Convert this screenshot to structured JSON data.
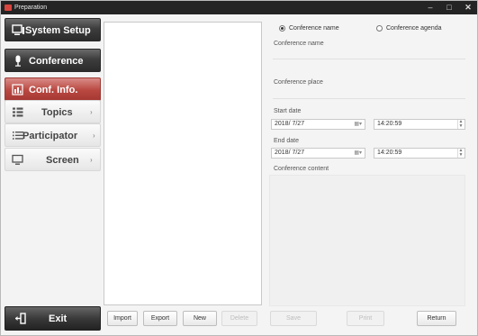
{
  "window": {
    "title": "Preparation",
    "min": "–",
    "max": "□",
    "close": "✕"
  },
  "sidebar": {
    "items": [
      {
        "label": "System Setup",
        "icon": "monitor-icon",
        "style": "dark"
      },
      {
        "label": "Conference",
        "icon": "microphone-icon",
        "style": "dark"
      },
      {
        "label": "Conf. Info.",
        "icon": "info-chart-icon",
        "style": "active"
      },
      {
        "label": "Topics",
        "icon": "list-icon",
        "style": "light",
        "chevron": "›"
      },
      {
        "label": "Participator",
        "icon": "list-lines-icon",
        "style": "light",
        "chevron": "›"
      },
      {
        "label": "Screen",
        "icon": "screen-icon",
        "style": "light",
        "chevron": "›"
      }
    ],
    "exit_label": "Exit"
  },
  "form": {
    "radio_name": "Conference name",
    "radio_agenda": "Conference agenda",
    "selected": "Conference name",
    "conference_name_label": "Conference name",
    "conference_place_label": "Conference place",
    "start_date_label": "Start date",
    "start_date": "2018/ 7/27",
    "start_time": "14:20:59",
    "end_date_label": "End date",
    "end_date": "2018/ 7/27",
    "end_time": "14:20:59",
    "content_label": "Conference content",
    "calendar_glyph": "▦▾",
    "spin_up": "▲",
    "spin_down": "▼"
  },
  "buttons": {
    "import": "Import",
    "export": "Export",
    "new": "New",
    "delete": "Delete",
    "save": "Save",
    "print": "Print",
    "return": "Return"
  },
  "colors": {
    "active_nav": "#b94841",
    "dark_nav": "#3d3d3d",
    "titlebar": "#242424"
  }
}
